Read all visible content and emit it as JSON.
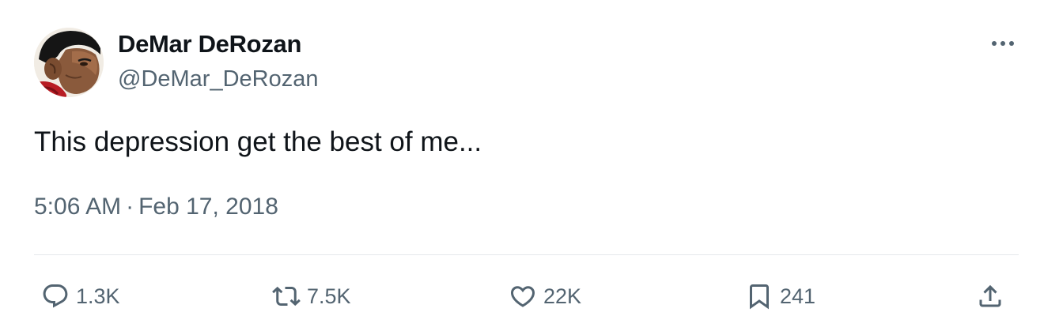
{
  "author": {
    "display_name": "DeMar DeRozan",
    "handle": "@DeMar_DeRozan",
    "avatar": "avatar-portrait"
  },
  "more_icon": "more-horizontal-icon",
  "tweet": {
    "text": "This depression get the best of me...",
    "time": "5:06 AM",
    "separator": "·",
    "date": "Feb 17, 2018"
  },
  "actions": {
    "reply": {
      "icon": "reply-icon",
      "count": "1.3K"
    },
    "retweet": {
      "icon": "retweet-icon",
      "count": "7.5K"
    },
    "like": {
      "icon": "heart-icon",
      "count": "22K"
    },
    "bookmark": {
      "icon": "bookmark-icon",
      "count": "241"
    },
    "share": {
      "icon": "share-icon"
    }
  },
  "colors": {
    "primary_text": "#0f1419",
    "secondary_text": "#536471",
    "divider": "#e6e9ec"
  }
}
